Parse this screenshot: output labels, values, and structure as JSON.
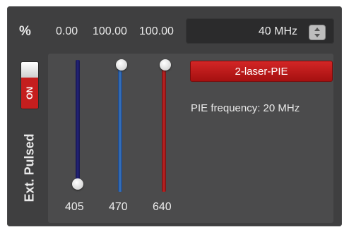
{
  "header": {
    "percent_symbol": "%",
    "power_values": [
      "0.00",
      "100.00",
      "100.00"
    ]
  },
  "frequency": {
    "value": "40 MHz"
  },
  "toggle": {
    "state_label": "ON"
  },
  "mode_label": "Ext. Pulsed",
  "lasers": [
    {
      "wavelength": "405",
      "level_percent": 0,
      "color": "#24247a"
    },
    {
      "wavelength": "470",
      "level_percent": 100,
      "color": "#3a78c4"
    },
    {
      "wavelength": "640",
      "level_percent": 100,
      "color": "#c42323"
    }
  ],
  "pie_button": {
    "label": "2-laser-PIE",
    "color": "#c51e1e"
  },
  "pie_frequency_text": "PIE frequency: 20 MHz"
}
